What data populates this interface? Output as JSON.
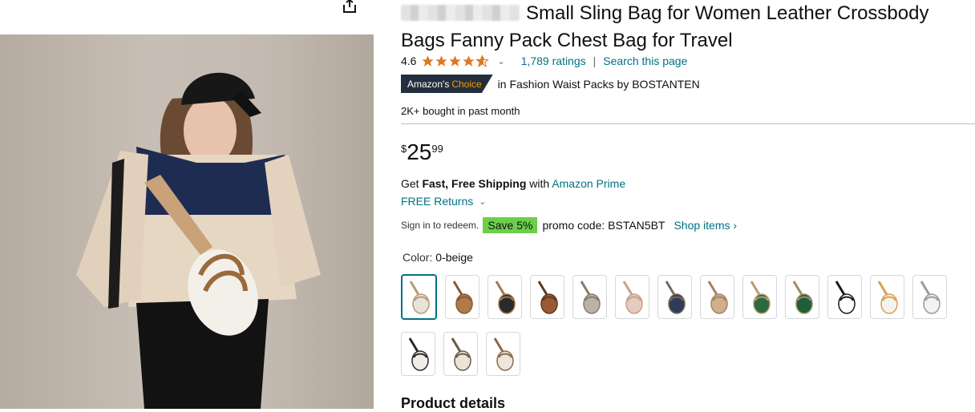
{
  "product": {
    "title": "Small Sling Bag for Women Leather Crossbody Bags Fanny Pack Chest Bag for Travel",
    "rating": "4.6",
    "ratings_count": "1,789 ratings",
    "search_link": "Search this page",
    "badge_label": "Amazon's",
    "badge_choice": "Choice",
    "badge_category": "in Fashion Waist Packs by BOSTANTEN",
    "bought": "2K+ bought in past month",
    "price_symbol": "$",
    "price_whole": "25",
    "price_fraction": "99",
    "shipping_get": "Get",
    "shipping_bold": "Fast, Free Shipping",
    "shipping_with": "with",
    "shipping_link": "Amazon Prime",
    "returns": "FREE Returns",
    "promo_signin": "Sign in to redeem.",
    "promo_save": "Save 5%",
    "promo_code": "promo code: BSTAN5BT",
    "promo_link": "Shop items ›",
    "color_label": "Color:",
    "color_value": "0-beige",
    "details_heading": "Product details"
  },
  "swatches": [
    {
      "name": "0-beige",
      "color": "#e8e2d8",
      "accent": "#b89a78",
      "selected": true
    },
    {
      "name": "brown",
      "color": "#b07a4a",
      "accent": "#8a5a32"
    },
    {
      "name": "black",
      "color": "#2a2a2a",
      "accent": "#a07850"
    },
    {
      "name": "brown-2",
      "color": "#9a5a36",
      "accent": "#5e3a20"
    },
    {
      "name": "gray",
      "color": "#bab3a8",
      "accent": "#8c7b68"
    },
    {
      "name": "pink",
      "color": "#e6cbc0",
      "accent": "#c9a08a"
    },
    {
      "name": "navy",
      "color": "#2f3b5a",
      "accent": "#7a6a5a"
    },
    {
      "name": "khaki",
      "color": "#cfb08c",
      "accent": "#a38462"
    },
    {
      "name": "green",
      "color": "#2a6a3e",
      "accent": "#b89a78"
    },
    {
      "name": "green-2",
      "color": "#1f5e3a",
      "accent": "#a08a68"
    },
    {
      "name": "black-white",
      "color": "#ffffff",
      "accent": "#1a1a1a"
    },
    {
      "name": "white-tan",
      "color": "#f5f3ee",
      "accent": "#d9a052"
    },
    {
      "name": "white-gray",
      "color": "#f2f2f2",
      "accent": "#9a9a9a"
    },
    {
      "name": "leopard-black",
      "color": "#f0ede8",
      "accent": "#2a2a2a"
    },
    {
      "name": "leopard-tan",
      "color": "#ece4d8",
      "accent": "#6b5a44"
    },
    {
      "name": "leopard-brown",
      "color": "#eee6da",
      "accent": "#8a6a4a"
    }
  ],
  "colors": {
    "link": "#007185",
    "badge_bg": "#232f3e",
    "badge_accent": "#ff9900",
    "star": "#de7921",
    "save_bg": "#6ccf4a"
  },
  "icons": {
    "share": "share-icon",
    "star": "star-icon",
    "chevron": "chevron-down-icon"
  }
}
